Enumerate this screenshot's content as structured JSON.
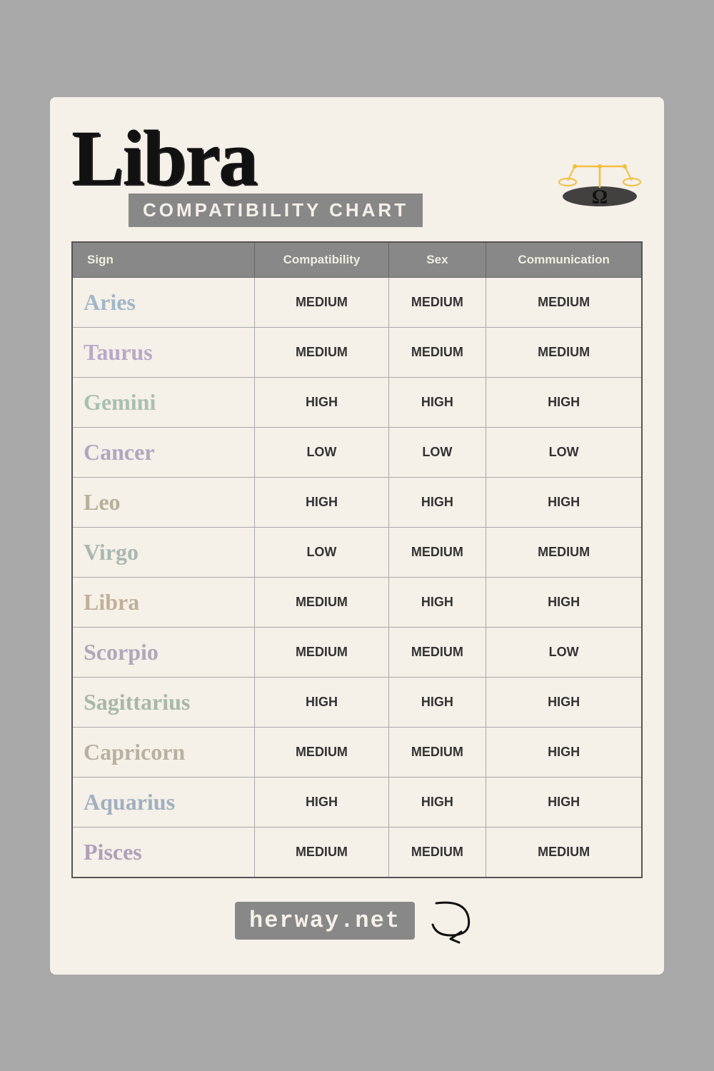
{
  "header": {
    "title": "Libra",
    "subtitle": "COMPATIBILITY CHART"
  },
  "table": {
    "headers": [
      "Sign",
      "Compatibility",
      "Sex",
      "Communication"
    ],
    "rows": [
      {
        "sign": "Aries",
        "signClass": "sign-aries",
        "compat": "MEDIUM",
        "sex": "MEDIUM",
        "comm": "MEDIUM"
      },
      {
        "sign": "Taurus",
        "signClass": "sign-taurus",
        "compat": "MEDIUM",
        "sex": "MEDIUM",
        "comm": "MEDIUM"
      },
      {
        "sign": "Gemini",
        "signClass": "sign-gemini",
        "compat": "HIGH",
        "sex": "HIGH",
        "comm": "HIGH"
      },
      {
        "sign": "Cancer",
        "signClass": "sign-cancer",
        "compat": "LOW",
        "sex": "LOW",
        "comm": "LOW"
      },
      {
        "sign": "Leo",
        "signClass": "sign-leo",
        "compat": "HIGH",
        "sex": "HIGH",
        "comm": "HIGH"
      },
      {
        "sign": "Virgo",
        "signClass": "sign-virgo",
        "compat": "LOW",
        "sex": "MEDIUM",
        "comm": "MEDIUM"
      },
      {
        "sign": "Libra",
        "signClass": "sign-libra",
        "compat": "MEDIUM",
        "sex": "HIGH",
        "comm": "HIGH"
      },
      {
        "sign": "Scorpio",
        "signClass": "sign-scorpio",
        "compat": "MEDIUM",
        "sex": "MEDIUM",
        "comm": "LOW"
      },
      {
        "sign": "Sagittarius",
        "signClass": "sign-sagittarius",
        "compat": "HIGH",
        "sex": "HIGH",
        "comm": "HIGH"
      },
      {
        "sign": "Capricorn",
        "signClass": "sign-capricorn",
        "compat": "MEDIUM",
        "sex": "MEDIUM",
        "comm": "HIGH"
      },
      {
        "sign": "Aquarius",
        "signClass": "sign-aquarius",
        "compat": "HIGH",
        "sex": "HIGH",
        "comm": "HIGH"
      },
      {
        "sign": "Pisces",
        "signClass": "sign-pisces",
        "compat": "MEDIUM",
        "sex": "MEDIUM",
        "comm": "MEDIUM"
      }
    ]
  },
  "footer": {
    "site": "herway.net"
  }
}
